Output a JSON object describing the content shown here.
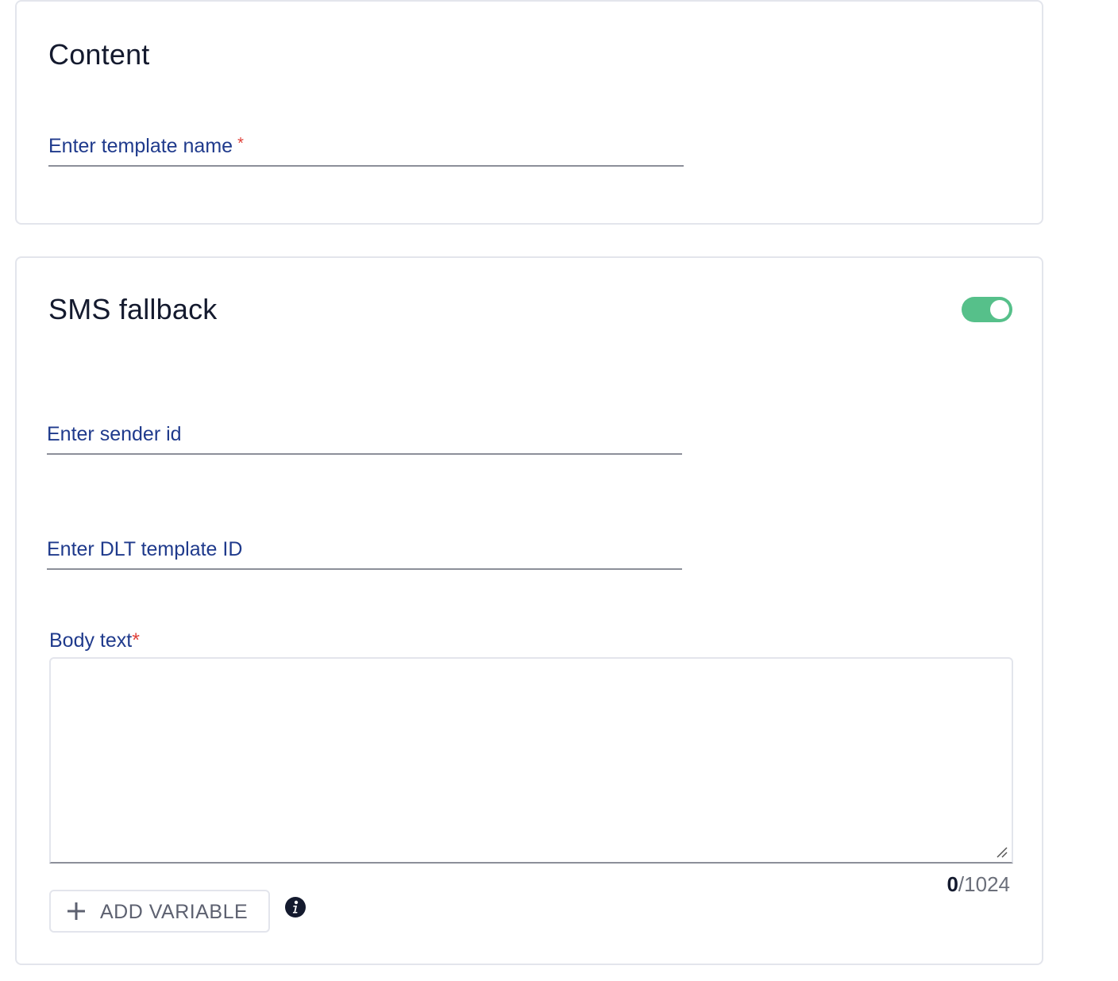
{
  "content_section": {
    "title": "Content",
    "template_name_label": "Enter template name",
    "required_marker": "*"
  },
  "sms_fallback": {
    "title": "SMS fallback",
    "toggle_enabled": true,
    "sender_id_label": "Enter sender id",
    "dlt_template_label": "Enter DLT template ID",
    "body_text_label": "Body text",
    "required_marker": "*",
    "char_count_current": "0",
    "char_count_max": "/1024",
    "add_variable_label": "ADD VARIABLE"
  },
  "colors": {
    "label_blue": "#1f3a8c",
    "required_red": "#e0413a",
    "toggle_green": "#56c08a",
    "title_dark": "#141a2e"
  },
  "icons": [
    "plus-icon",
    "info-icon",
    "resize-grip-icon"
  ]
}
